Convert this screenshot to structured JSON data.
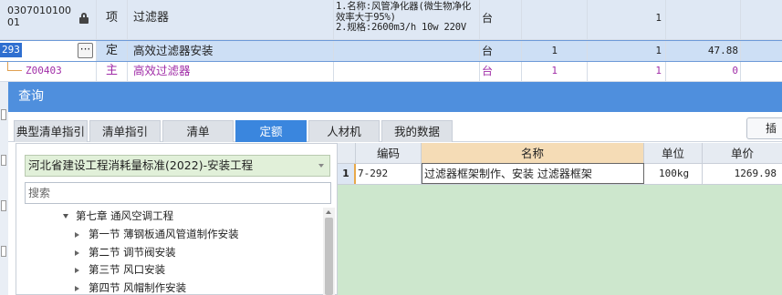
{
  "grid": {
    "row1": {
      "code": "030701010001",
      "type": "项",
      "name": "过滤器",
      "features": "1.名称:风管净化器(微生物净化效率大于95%)\n2.规格:2600m3/h 10w 220V",
      "unit": "台",
      "qty1": "",
      "qty2": "1",
      "price": ""
    },
    "row2": {
      "code": "293",
      "type": "定",
      "name": "高效过滤器安装",
      "features": "",
      "unit": "台",
      "qty1": "1",
      "qty2": "1",
      "price": "47.88",
      "more_btn": "···"
    },
    "row3": {
      "code": "Z00403",
      "type": "主",
      "name": "高效过滤器",
      "features": "",
      "unit": "台",
      "qty1": "1",
      "qty2": "1",
      "price": "0"
    }
  },
  "dialog": {
    "title": "查询",
    "tabs": [
      "典型清单指引",
      "清单指引",
      "清单",
      "定额",
      "人材机",
      "我的数据"
    ],
    "active_tab": "定额",
    "insert_label": "插入",
    "standard": "河北省建设工程消耗量标准(2022)-安装工程",
    "search_placeholder": "搜索",
    "tree": {
      "chapter": "第七章 通风空调工程",
      "sections": [
        "第一节 薄钢板通风管道制作安装",
        "第二节 调节阀安装",
        "第三节 风口安装",
        "第四节 风帽制作安装"
      ]
    },
    "results": {
      "headers": {
        "code": "编码",
        "name": "名称",
        "unit": "单位",
        "price": "单价"
      },
      "rows": [
        {
          "idx": "1",
          "code": "7-292",
          "name": "过滤器框架制作、安装 过滤器框架",
          "unit": "100kg",
          "price": "1269.98"
        }
      ]
    }
  },
  "colors": {
    "title_bar": "#4f8fdd",
    "active_tab": "#3a86de",
    "selected_row": "#cddff5",
    "main_material_text": "#a12ea8",
    "result_area": "#cde7cd"
  }
}
